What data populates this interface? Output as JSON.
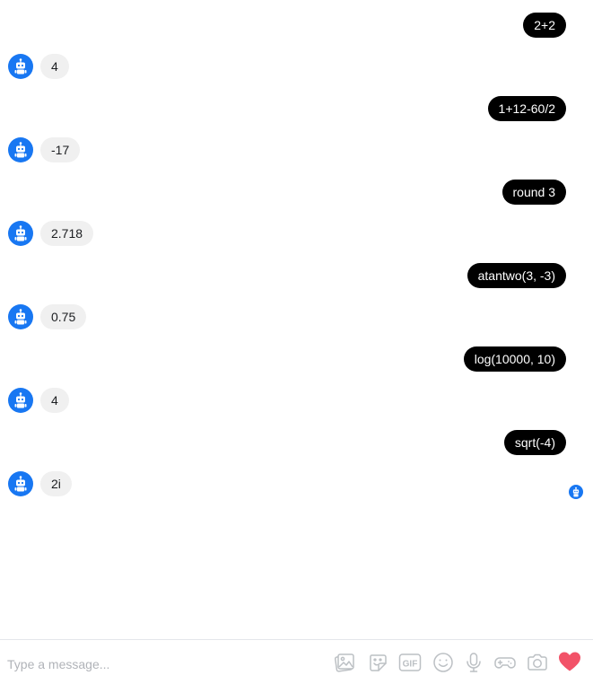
{
  "conversation": {
    "messages": [
      {
        "sender": "user",
        "text": "2+2"
      },
      {
        "sender": "bot",
        "text": "4"
      },
      {
        "sender": "user",
        "text": "1+12-60/2"
      },
      {
        "sender": "bot",
        "text": "-17"
      },
      {
        "sender": "user",
        "text": "round 3"
      },
      {
        "sender": "bot",
        "text": "2.718"
      },
      {
        "sender": "user",
        "text": "atantwo(3, -3)"
      },
      {
        "sender": "bot",
        "text": "0.75"
      },
      {
        "sender": "user",
        "text": "log(10000, 10)"
      },
      {
        "sender": "bot",
        "text": "4"
      },
      {
        "sender": "user",
        "text": "sqrt(-4)"
      },
      {
        "sender": "bot",
        "text": "2i"
      }
    ]
  },
  "composer": {
    "placeholder": "Type a message...",
    "gif_label": "GIF",
    "tools": [
      "photo-icon",
      "sticker-icon",
      "gif-icon",
      "emoji-icon",
      "microphone-icon",
      "game-controller-icon",
      "camera-icon",
      "heart-like-icon"
    ]
  },
  "colors": {
    "user_bubble": "#000000",
    "bot_bubble": "#f0f0f0",
    "accent": "#1877f2",
    "like": "#f25268",
    "tool_icon": "#bcc0c4"
  }
}
